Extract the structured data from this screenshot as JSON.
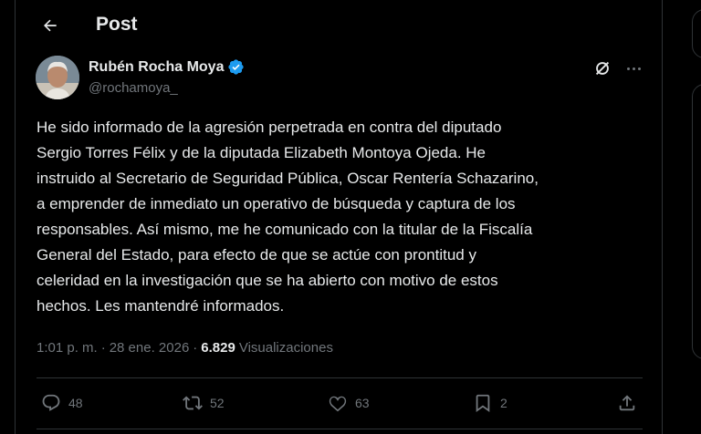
{
  "header": {
    "title": "Post"
  },
  "author": {
    "name": "Rubén Rocha Moya",
    "handle": "@rochamoya_"
  },
  "post": {
    "text": "He sido informado de la agresión perpetrada en contra del diputado\nSergio Torres Félix y de la diputada Elizabeth  Montoya Ojeda. He\ninstruido al Secretario de Seguridad Pública, Oscar Rentería Schazarino,\na  emprender de inmediato un operativo de búsqueda y captura de los\nresponsables. Así mismo, me he comunicado con la titular de la Fiscalía\nGeneral del Estado, para efecto de que se actúe con prontitud y\nceleridad en la investigación que se ha abierto con motivo de estos\nhechos. Les mantendré informados.",
    "time": "1:01 p. m.",
    "separator": "·",
    "date": "28 ene. 2026",
    "views_count": "6.829",
    "views_label": "Visualizaciones"
  },
  "actions": {
    "replies": "48",
    "reposts": "52",
    "likes": "63",
    "bookmarks": "2"
  },
  "colors": {
    "background": "#000000",
    "text": "#e7e9ea",
    "muted": "#71767b",
    "border": "#2f3336",
    "verified": "#1d9bf0"
  }
}
